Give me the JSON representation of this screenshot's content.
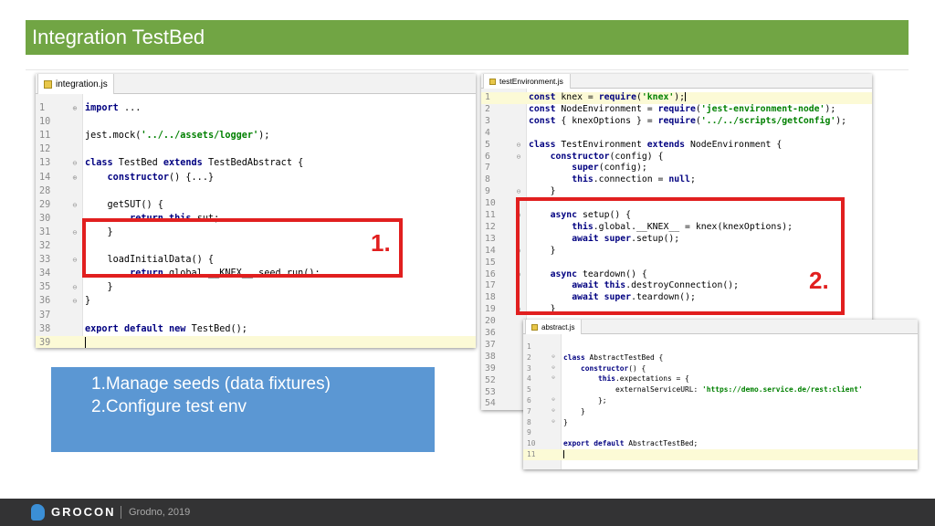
{
  "slide": {
    "title": "Integration TestBed",
    "notes": [
      "1.Manage seeds (data fixtures)",
      "2.Configure test env"
    ],
    "callouts": [
      "1.",
      "2."
    ]
  },
  "colors": {
    "title_bar": "#71a544",
    "highlight": "#e11f1f",
    "note_box": "#5b97d3",
    "footer": "#333334",
    "logo": "#3b8fd6"
  },
  "editors": [
    {
      "tab": "integration.js",
      "tab_icon": "js-file-icon",
      "lines": [
        {
          "n": "1",
          "f": "⊕",
          "t": "import ..."
        },
        {
          "n": "10",
          "f": "",
          "t": ""
        },
        {
          "n": "11",
          "f": "",
          "t": "jest.mock('../../assets/logger');"
        },
        {
          "n": "12",
          "f": "",
          "t": ""
        },
        {
          "n": "13",
          "f": "⊖",
          "t": "class TestBed extends TestBedAbstract {"
        },
        {
          "n": "14",
          "f": "⊕",
          "t": "    constructor() {...}"
        },
        {
          "n": "28",
          "f": "",
          "t": ""
        },
        {
          "n": "29",
          "f": "⊖",
          "t": "    getSUT() {"
        },
        {
          "n": "30",
          "f": "",
          "t": "        return this.sut;"
        },
        {
          "n": "31",
          "f": "⊖",
          "t": "    }"
        },
        {
          "n": "32",
          "f": "",
          "t": ""
        },
        {
          "n": "33",
          "f": "⊖",
          "t": "    loadInitialData() {"
        },
        {
          "n": "34",
          "f": "",
          "t": "        return global.__KNEX__.seed.run();"
        },
        {
          "n": "35",
          "f": "⊖",
          "t": "    }"
        },
        {
          "n": "36",
          "f": "⊖",
          "t": "}"
        },
        {
          "n": "37",
          "f": "",
          "t": ""
        },
        {
          "n": "38",
          "f": "",
          "t": "export default new TestBed();"
        },
        {
          "n": "39",
          "f": "",
          "t": ""
        }
      ]
    },
    {
      "tab": "testEnvironment.js",
      "tab_icon": "js-file-icon",
      "lines": [
        {
          "n": "1",
          "f": "",
          "t": "const knex = require('knex');"
        },
        {
          "n": "2",
          "f": "",
          "t": "const NodeEnvironment = require('jest-environment-node');"
        },
        {
          "n": "3",
          "f": "",
          "t": "const { knexOptions } = require('../../scripts/getConfig');"
        },
        {
          "n": "4",
          "f": "",
          "t": ""
        },
        {
          "n": "5",
          "f": "⊖",
          "t": "class TestEnvironment extends NodeEnvironment {"
        },
        {
          "n": "6",
          "f": "⊖",
          "t": "    constructor(config) {"
        },
        {
          "n": "7",
          "f": "",
          "t": "        super(config);"
        },
        {
          "n": "8",
          "f": "",
          "t": "        this.connection = null;"
        },
        {
          "n": "9",
          "f": "⊖",
          "t": "    }"
        },
        {
          "n": "10",
          "f": "",
          "t": ""
        },
        {
          "n": "11",
          "f": "⊖",
          "t": "    async setup() {"
        },
        {
          "n": "12",
          "f": "",
          "t": "        this.global.__KNEX__ = knex(knexOptions);"
        },
        {
          "n": "13",
          "f": "",
          "t": "        await super.setup();"
        },
        {
          "n": "14",
          "f": "⊖",
          "t": "    }"
        },
        {
          "n": "15",
          "f": "",
          "t": ""
        },
        {
          "n": "16",
          "f": "⊖",
          "t": "    async teardown() {"
        },
        {
          "n": "17",
          "f": "",
          "t": "        await this.destroyConnection();"
        },
        {
          "n": "18",
          "f": "",
          "t": "        await super.teardown();"
        },
        {
          "n": "19",
          "f": "⊖",
          "t": "    }"
        },
        {
          "n": "20",
          "f": "",
          "t": ""
        },
        {
          "n": "36",
          "f": "",
          "t": ""
        },
        {
          "n": "37",
          "f": "",
          "t": ""
        },
        {
          "n": "38",
          "f": "",
          "t": ""
        },
        {
          "n": "39",
          "f": "",
          "t": ""
        },
        {
          "n": "52",
          "f": "",
          "t": ""
        },
        {
          "n": "53",
          "f": "",
          "t": ""
        },
        {
          "n": "54",
          "f": "",
          "t": ""
        }
      ]
    },
    {
      "tab": "abstract.js",
      "tab_icon": "js-file-icon",
      "lines": [
        {
          "n": "1",
          "f": "",
          "t": ""
        },
        {
          "n": "2",
          "f": "⊖",
          "t": "class AbstractTestBed {"
        },
        {
          "n": "3",
          "f": "⊖",
          "t": "    constructor() {"
        },
        {
          "n": "4",
          "f": "⊖",
          "t": "        this.expectations = {"
        },
        {
          "n": "5",
          "f": "",
          "t": "            externalServiceURL: 'https://demo.service.de/rest:client'"
        },
        {
          "n": "6",
          "f": "⊖",
          "t": "        };"
        },
        {
          "n": "7",
          "f": "⊖",
          "t": "    }"
        },
        {
          "n": "8",
          "f": "⊖",
          "t": "}"
        },
        {
          "n": "9",
          "f": "",
          "t": ""
        },
        {
          "n": "10",
          "f": "",
          "t": "export default AbstractTestBed;"
        },
        {
          "n": "11",
          "f": "",
          "t": ""
        }
      ]
    }
  ],
  "footer": {
    "brand": "GROCON",
    "event": "Grodno, 2019",
    "logo_icon": "grocon-logo-icon"
  }
}
